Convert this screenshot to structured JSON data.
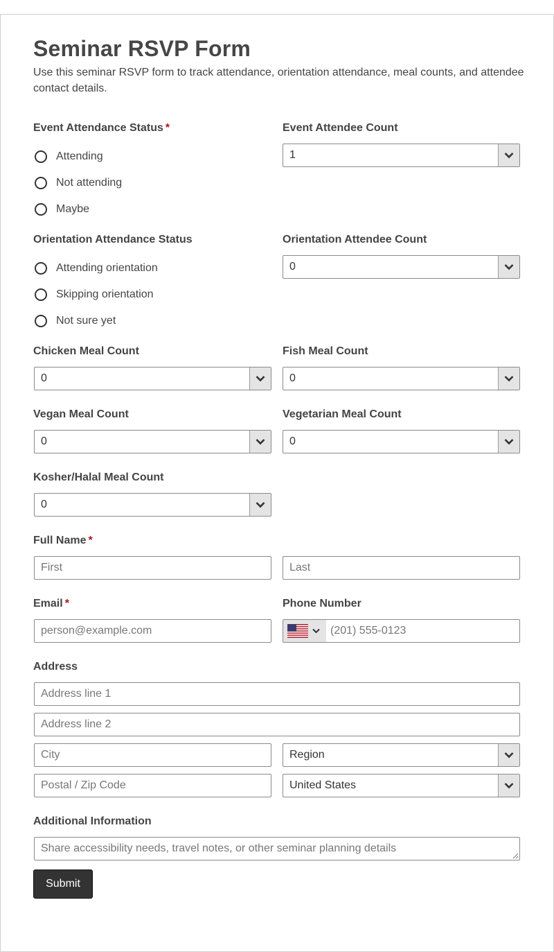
{
  "form": {
    "title": "Seminar RSVP Form",
    "description": "Use this seminar RSVP form to track attendance, orientation attendance, meal counts, and attendee contact details."
  },
  "event_attendance": {
    "label": "Event Attendance Status",
    "required_mark": "*",
    "options": [
      "Attending",
      "Not attending",
      "Maybe"
    ]
  },
  "event_attendee_count": {
    "label": "Event Attendee Count",
    "value": "1"
  },
  "orientation_attendance": {
    "label": "Orientation Attendance Status",
    "options": [
      "Attending orientation",
      "Skipping orientation",
      "Not sure yet"
    ]
  },
  "orientation_attendee_count": {
    "label": "Orientation Attendee Count",
    "value": "0"
  },
  "meals": {
    "chicken": {
      "label": "Chicken Meal Count",
      "value": "0"
    },
    "fish": {
      "label": "Fish Meal Count",
      "value": "0"
    },
    "vegan": {
      "label": "Vegan Meal Count",
      "value": "0"
    },
    "vegetarian": {
      "label": "Vegetarian Meal Count",
      "value": "0"
    },
    "kosher_halal": {
      "label": "Kosher/Halal Meal Count",
      "value": "0"
    }
  },
  "full_name": {
    "label": "Full Name",
    "required_mark": "*",
    "first_placeholder": "First",
    "last_placeholder": "Last"
  },
  "email": {
    "label": "Email",
    "required_mark": "*",
    "placeholder": "person@example.com"
  },
  "phone": {
    "label": "Phone Number",
    "placeholder": "(201) 555-0123",
    "country_flag": "us-flag-icon"
  },
  "address": {
    "label": "Address",
    "line1_placeholder": "Address line 1",
    "line2_placeholder": "Address line 2",
    "city_placeholder": "City",
    "region_value": "Region",
    "postal_placeholder": "Postal / Zip Code",
    "country_value": "United States"
  },
  "additional_info": {
    "label": "Additional Information",
    "placeholder": "Share accessibility needs, travel notes, or other seminar planning details"
  },
  "submit_label": "Submit",
  "colors": {
    "required": "#b0111a",
    "button": "#333333",
    "select_button": "#e4e4e4"
  }
}
